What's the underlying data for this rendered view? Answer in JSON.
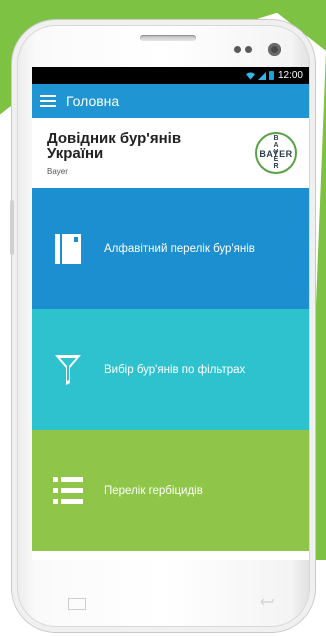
{
  "status_bar": {
    "time": "12:00"
  },
  "app_bar": {
    "title": "Головна"
  },
  "header": {
    "title": "Довідник бур'янів України",
    "subtitle": "Bayer",
    "logo": {
      "vertical": "B A Y E R",
      "horizontal": "BAYER"
    }
  },
  "menu": [
    {
      "label": "Алфавітний перелік бур'янів",
      "icon": "book-icon",
      "color": "#1b8fd0"
    },
    {
      "label": "Вибір бур'янів по фільтрах",
      "icon": "filter-icon",
      "color": "#2ec2cf"
    },
    {
      "label": "Перелік гербіцидів",
      "icon": "list-icon",
      "color": "#8fc548"
    }
  ],
  "colors": {
    "accent": "#1f95d3",
    "brand_green": "#7dc243"
  }
}
